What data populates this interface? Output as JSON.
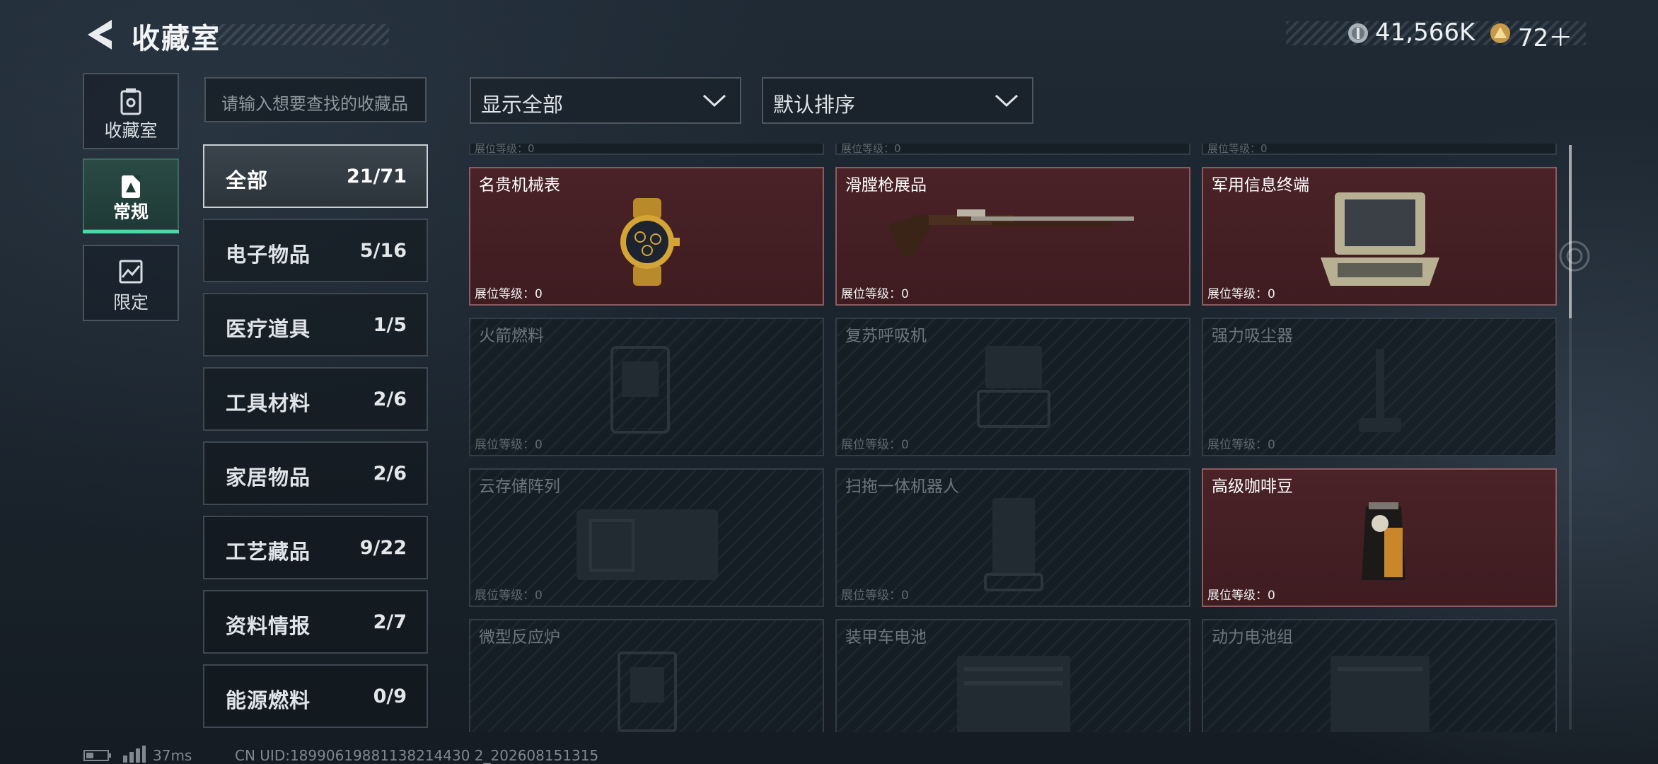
{
  "header": {
    "title": "收藏室",
    "currency_primary": "41,566K",
    "currency_secondary": "72＋"
  },
  "rail": [
    {
      "label": "收藏室",
      "icon": "collection-room-icon",
      "active": false
    },
    {
      "label": "常规",
      "icon": "standard-icon",
      "active": true
    },
    {
      "label": "限定",
      "icon": "limited-icon",
      "active": false
    }
  ],
  "search": {
    "placeholder": "请输入想要查找的收藏品"
  },
  "categories": [
    {
      "name": "全部",
      "count": "21/71",
      "active": true
    },
    {
      "name": "电子物品",
      "count": "5/16"
    },
    {
      "name": "医疗道具",
      "count": "1/5"
    },
    {
      "name": "工具材料",
      "count": "2/6"
    },
    {
      "name": "家居物品",
      "count": "2/6"
    },
    {
      "name": "工艺藏品",
      "count": "9/22"
    },
    {
      "name": "资料情报",
      "count": "2/7"
    },
    {
      "name": "能源燃料",
      "count": "0/9"
    }
  ],
  "filters": {
    "display": "显示全部",
    "sort": "默认排序"
  },
  "partial_row": {
    "level_label": "展位等级：0"
  },
  "items": [
    {
      "name": "名贵机械表",
      "level": "展位等级：0",
      "owned": true,
      "icon": "luxury-watch-icon"
    },
    {
      "name": "滑膛枪展品",
      "level": "展位等级：0",
      "owned": true,
      "icon": "musket-icon"
    },
    {
      "name": "军用信息终端",
      "level": "展位等级：0",
      "owned": true,
      "icon": "military-terminal-icon"
    },
    {
      "name": "火箭燃料",
      "level": "展位等级：0",
      "owned": false,
      "icon": "rocket-fuel-icon"
    },
    {
      "name": "复苏呼吸机",
      "level": "展位等级：0",
      "owned": false,
      "icon": "ventilator-icon"
    },
    {
      "name": "强力吸尘器",
      "level": "展位等级：0",
      "owned": false,
      "icon": "vacuum-cleaner-icon"
    },
    {
      "name": "云存储阵列",
      "level": "展位等级：0",
      "owned": false,
      "icon": "storage-array-icon"
    },
    {
      "name": "扫拖一体机器人",
      "level": "展位等级：0",
      "owned": false,
      "icon": "robot-vacuum-icon"
    },
    {
      "name": "高级咖啡豆",
      "level": "展位等级：0",
      "owned": true,
      "icon": "coffee-beans-icon"
    },
    {
      "name": "微型反应炉",
      "level": "",
      "owned": false,
      "icon": "micro-reactor-icon"
    },
    {
      "name": "装甲车电池",
      "level": "",
      "owned": false,
      "icon": "vehicle-battery-icon"
    },
    {
      "name": "动力电池组",
      "level": "",
      "owned": false,
      "icon": "power-battery-icon"
    }
  ],
  "footer": {
    "ping": "37ms",
    "uid": "CN UID:18990619881138214430 2_202608151315"
  },
  "colors": {
    "accent_green": "#4ed6a5",
    "owned_card": "#4a2227",
    "locked_card": "#161e25"
  }
}
